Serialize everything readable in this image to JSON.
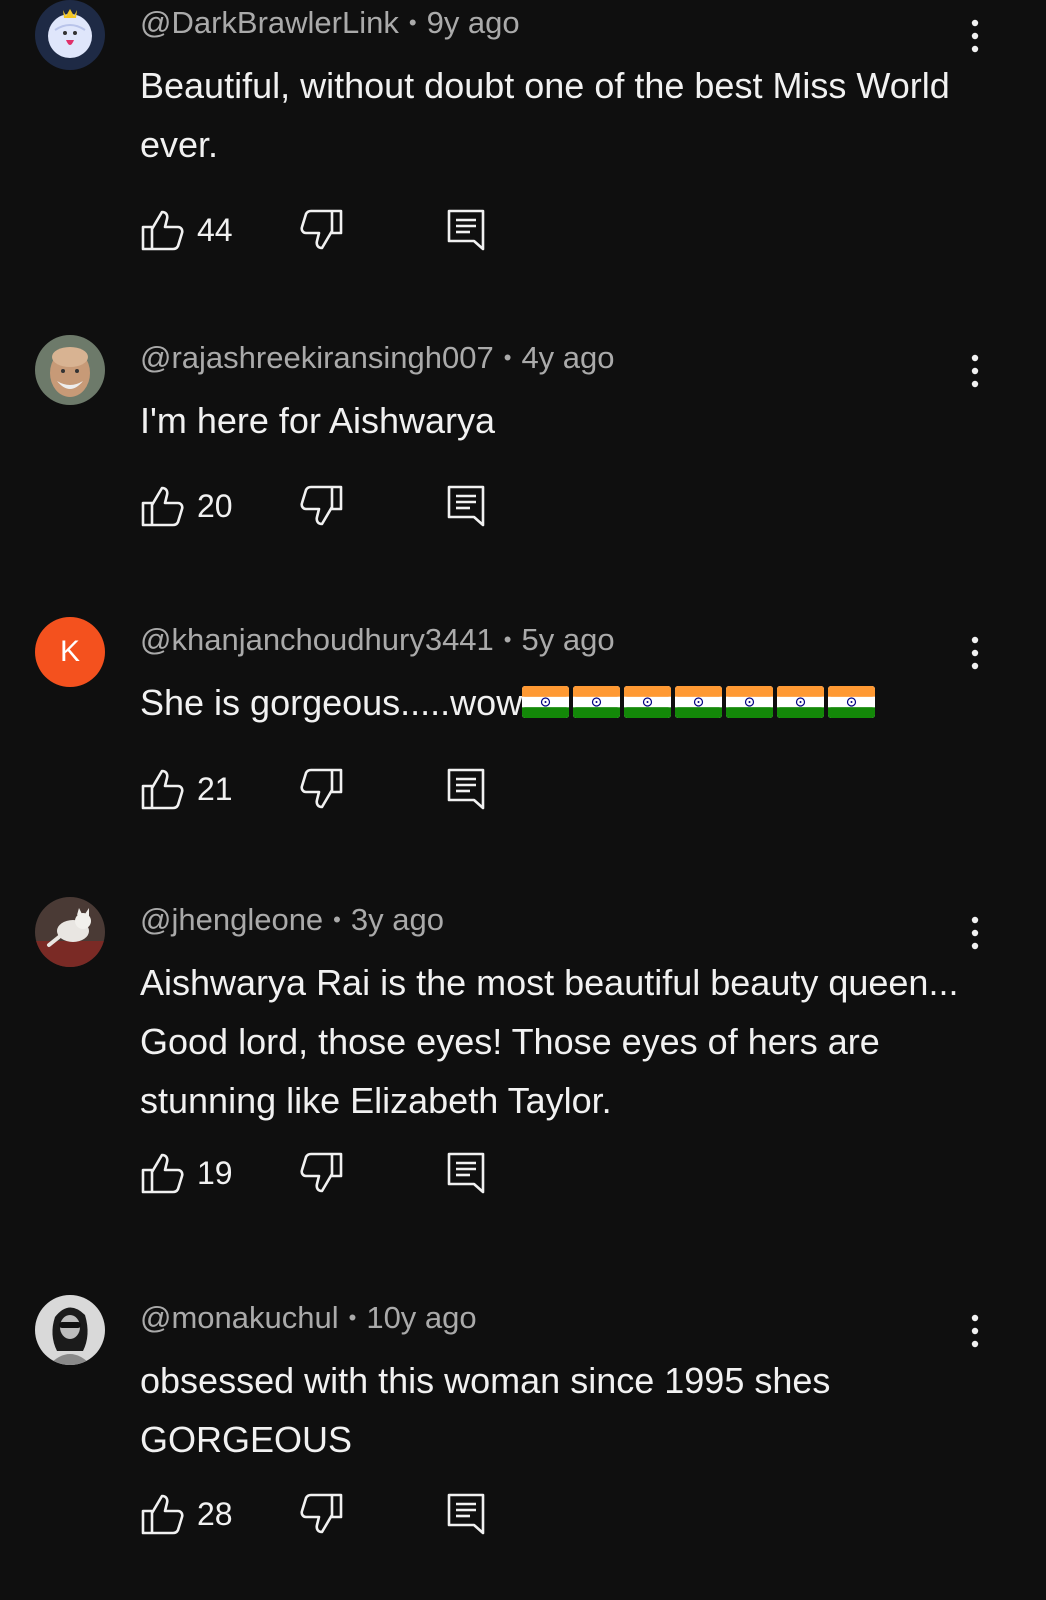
{
  "comments": [
    {
      "author": "@DarkBrawlerLink",
      "separator": "•",
      "time": "9y ago",
      "text": "Beautiful, without doubt one of the best Miss World ever.",
      "likes": "44",
      "avatar": "ghost-avatar"
    },
    {
      "author": "@rajashreekiransingh007",
      "separator": "•",
      "time": "4y ago",
      "text": "I'm here for Aishwarya",
      "likes": "20",
      "avatar": "photo-avatar"
    },
    {
      "author": "@khanjanchoudhury3441",
      "separator": "•",
      "time": "5y ago",
      "text": "She is gorgeous.....wow",
      "emoji": "🇮🇳🇮🇳🇮🇳🇮🇳🇮🇳🇮🇳🇮🇳",
      "likes": "21",
      "avatar_letter": "K",
      "avatar_color": "#f4511e"
    },
    {
      "author": "@jhengleone",
      "separator": "•",
      "time": "3y ago",
      "text": "Aishwarya Rai is the most beautiful beauty queen... Good lord, those eyes! Those eyes of hers are stunning like Elizabeth Taylor.",
      "likes": "19",
      "avatar": "cat-photo-avatar"
    },
    {
      "author": "@monakuchul",
      "separator": "•",
      "time": "10y ago",
      "text": "obsessed with this woman since 1995 shes GORGEOUS",
      "likes": "28",
      "avatar": "bw-photo-avatar"
    }
  ],
  "icons": {
    "like": "thumbs-up-icon",
    "dislike": "thumbs-down-icon",
    "reply": "reply-icon",
    "more": "more-vert-icon"
  },
  "colors": {
    "background": "#0f0f0f",
    "primary_text": "#f1f1f1",
    "secondary_text": "#aaaaaa"
  }
}
